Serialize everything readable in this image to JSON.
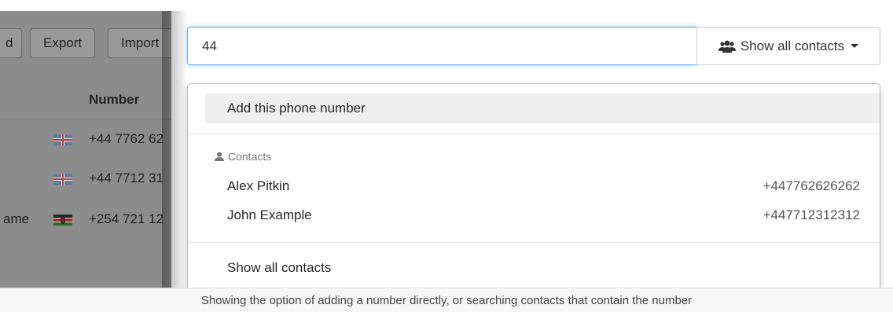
{
  "background": {
    "buttons": {
      "partial": "d",
      "export": "Export",
      "import": "Import"
    },
    "column_header": "Number",
    "rows": [
      {
        "name": "",
        "flag": "uk-flag",
        "phone": "+44 7762 62"
      },
      {
        "name": "",
        "flag": "uk-flag",
        "phone": "+44 7712 31"
      },
      {
        "name": "ame",
        "flag": "kenya-flag",
        "phone": "+254 721 12"
      }
    ]
  },
  "search": {
    "value": "44"
  },
  "contacts_button": {
    "label": "Show all contacts",
    "icon": "users-icon"
  },
  "dropdown": {
    "add_label": "Add this phone number",
    "contacts_header": "Contacts",
    "contacts_header_icon": "user-icon",
    "contacts": [
      {
        "name": "Alex Pitkin",
        "number": "+447762626262"
      },
      {
        "name": "John Example",
        "number": "+447712312312"
      }
    ],
    "show_all": "Show all contacts"
  },
  "caption": "Showing the option of adding a number directly, or searching contacts that contain the number",
  "colors": {
    "focus_border": "#66afe9",
    "highlight_bg": "#efefef",
    "dim_overlay": "#8c8c8c"
  }
}
